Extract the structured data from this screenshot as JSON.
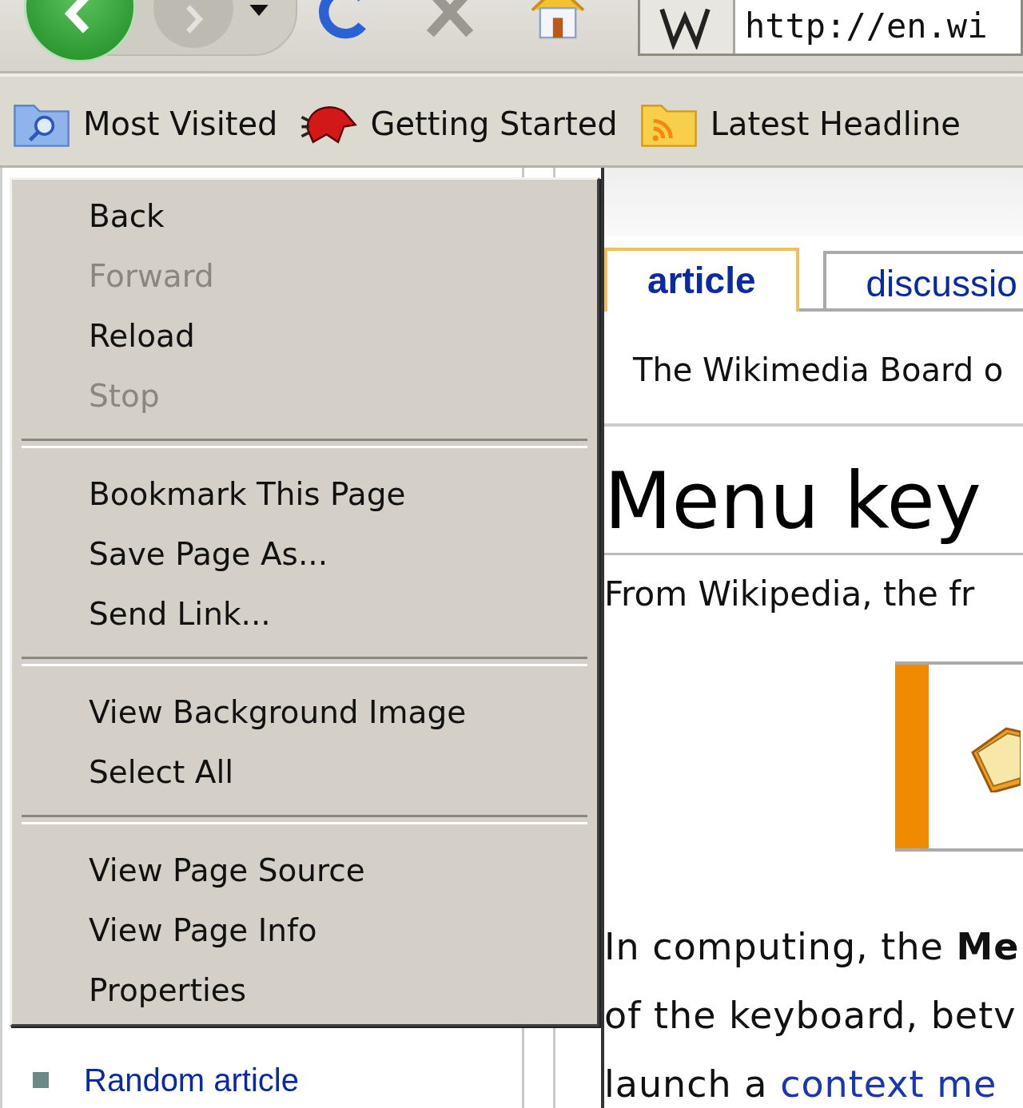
{
  "toolbar": {
    "address": "http://en.wi"
  },
  "bookmarks": [
    {
      "label": "Most Visited",
      "kind": "search-folder"
    },
    {
      "label": "Getting Started",
      "kind": "site"
    },
    {
      "label": "Latest Headline",
      "kind": "feed-folder"
    }
  ],
  "sidebar": {
    "links": [
      "Random article"
    ]
  },
  "content": {
    "tabs": [
      {
        "label": "article",
        "selected": true
      },
      {
        "label": "discussio",
        "selected": false
      }
    ],
    "notice": "The Wikimedia Board o",
    "heading": "Menu key",
    "tagline": "From Wikipedia, the fr",
    "lines": [
      [
        {
          "kind": "text",
          "text": "In computing, the **Me**"
        }
      ],
      [
        {
          "kind": "text",
          "text": "of the keyboard, betv"
        }
      ],
      [
        {
          "kind": "text",
          "text": "launch a "
        },
        {
          "kind": "link",
          "text": "context me"
        }
      ]
    ]
  },
  "context_menu": {
    "groups": [
      [
        {
          "label": "Back",
          "disabled": false
        },
        {
          "label": "Forward",
          "disabled": true
        },
        {
          "label": "Reload",
          "disabled": false
        },
        {
          "label": "Stop",
          "disabled": true
        }
      ],
      [
        {
          "label": "Bookmark This Page",
          "disabled": false
        },
        {
          "label": "Save Page As...",
          "disabled": false
        },
        {
          "label": "Send Link...",
          "disabled": false
        }
      ],
      [
        {
          "label": "View Background Image",
          "disabled": false
        },
        {
          "label": "Select All",
          "disabled": false
        }
      ],
      [
        {
          "label": "View Page Source",
          "disabled": false
        },
        {
          "label": "View Page Info",
          "disabled": false
        },
        {
          "label": "Properties",
          "disabled": false
        }
      ]
    ]
  }
}
